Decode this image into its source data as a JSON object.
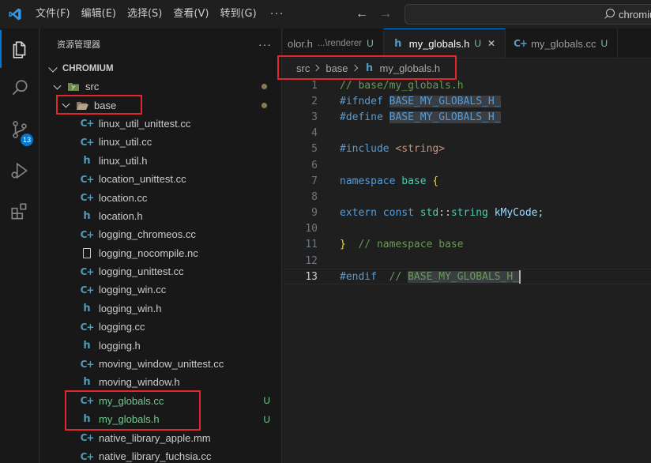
{
  "titlebar": {
    "menus": [
      "文件(F)",
      "编辑(E)",
      "选择(S)",
      "查看(V)",
      "转到(G)"
    ],
    "more": "···",
    "search_text": "chromiu"
  },
  "activitybar": {
    "items": [
      "explorer-icon",
      "search-icon",
      "source-control-icon",
      "run-debug-icon",
      "extensions-icon"
    ],
    "scm_badge": "13",
    "accent_color": "#0078d4"
  },
  "sidebar": {
    "title": "资源管理器",
    "more": "···",
    "workspace": "CHROMIUM",
    "folders": [
      {
        "label": "src",
        "depth": 1
      },
      {
        "label": "base",
        "depth": 2
      }
    ],
    "files": [
      {
        "name": "linux_util_unittest.cc",
        "type": "cc",
        "status": ""
      },
      {
        "name": "linux_util.cc",
        "type": "cc",
        "status": ""
      },
      {
        "name": "linux_util.h",
        "type": "h",
        "status": ""
      },
      {
        "name": "location_unittest.cc",
        "type": "cc",
        "status": ""
      },
      {
        "name": "location.cc",
        "type": "cc",
        "status": ""
      },
      {
        "name": "location.h",
        "type": "h",
        "status": ""
      },
      {
        "name": "logging_chromeos.cc",
        "type": "cc",
        "status": ""
      },
      {
        "name": "logging_nocompile.nc",
        "type": "file",
        "status": ""
      },
      {
        "name": "logging_unittest.cc",
        "type": "cc",
        "status": ""
      },
      {
        "name": "logging_win.cc",
        "type": "cc",
        "status": ""
      },
      {
        "name": "logging_win.h",
        "type": "h",
        "status": ""
      },
      {
        "name": "logging.cc",
        "type": "cc",
        "status": ""
      },
      {
        "name": "logging.h",
        "type": "h",
        "status": ""
      },
      {
        "name": "moving_window_unittest.cc",
        "type": "cc",
        "status": ""
      },
      {
        "name": "moving_window.h",
        "type": "h",
        "status": ""
      },
      {
        "name": "my_globals.cc",
        "type": "cc",
        "status": "U"
      },
      {
        "name": "my_globals.h",
        "type": "h",
        "status": "U"
      },
      {
        "name": "native_library_apple.mm",
        "type": "cc",
        "status": ""
      },
      {
        "name": "native_library_fuchsia.cc",
        "type": "cc",
        "status": ""
      }
    ],
    "untracked_color": "#73c991"
  },
  "editor": {
    "tabs": [
      {
        "name": "olor.h",
        "desc": "...\\renderer",
        "status": "U",
        "type": "none",
        "active": false
      },
      {
        "name": "my_globals.h",
        "desc": "",
        "status": "U",
        "type": "h",
        "active": true
      },
      {
        "name": "my_globals.cc",
        "desc": "",
        "status": "U",
        "type": "cc",
        "active": false
      }
    ],
    "breadcrumb": [
      "src",
      "base",
      "my_globals.h"
    ],
    "code_lines": [
      "// base/my_globals.h",
      "#ifndef BASE_MY_GLOBALS_H_",
      "#define BASE_MY_GLOBALS_H_",
      "",
      "#include <string>",
      "",
      "namespace base {",
      "",
      "extern const std::string kMyCode;",
      "",
      "}  // namespace base",
      "",
      "#endif  // BASE_MY_GLOBALS_H_"
    ],
    "current_line": 13
  }
}
